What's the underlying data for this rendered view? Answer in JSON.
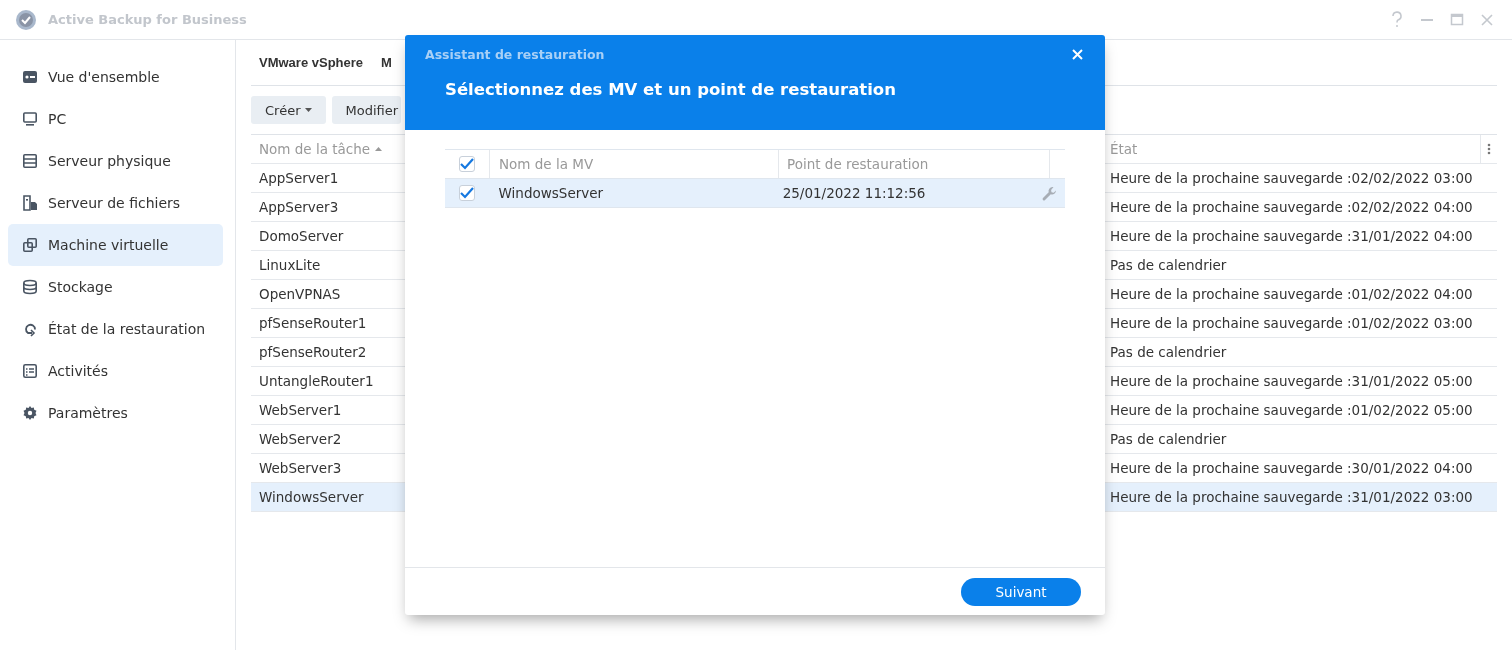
{
  "window": {
    "title": "Active Backup for Business"
  },
  "sidebar": {
    "items": [
      {
        "label": "Vue d'ensemble",
        "selected": false
      },
      {
        "label": "PC",
        "selected": false
      },
      {
        "label": "Serveur physique",
        "selected": false
      },
      {
        "label": "Serveur de fichiers",
        "selected": false
      },
      {
        "label": "Machine virtuelle",
        "selected": true
      },
      {
        "label": "Stockage",
        "selected": false
      },
      {
        "label": "État de la restauration",
        "selected": false
      },
      {
        "label": "Activités",
        "selected": false
      },
      {
        "label": "Paramètres",
        "selected": false
      }
    ]
  },
  "tabs": [
    {
      "label": "VMware vSphere"
    },
    {
      "label": "M"
    }
  ],
  "toolbar": {
    "buttons": [
      {
        "label": "Créer",
        "menu": true
      },
      {
        "label": "Modifier",
        "menu": false
      }
    ]
  },
  "table": {
    "columns": [
      {
        "label": "Nom de la tâche",
        "sorted": true
      },
      {
        "label": "État",
        "sorted": false
      }
    ],
    "rows": [
      {
        "name": "AppServer1",
        "state": "Heure de la prochaine sauvegarde :02/02/2022 03:00",
        "selected": false
      },
      {
        "name": "AppServer3",
        "state": "Heure de la prochaine sauvegarde :02/02/2022 04:00",
        "selected": false
      },
      {
        "name": "DomoServer",
        "state": "Heure de la prochaine sauvegarde :31/01/2022 04:00",
        "selected": false
      },
      {
        "name": "LinuxLite",
        "state": "Pas de calendrier",
        "selected": false
      },
      {
        "name": "OpenVPNAS",
        "state": "Heure de la prochaine sauvegarde :01/02/2022 04:00",
        "selected": false
      },
      {
        "name": "pfSenseRouter1",
        "state": "Heure de la prochaine sauvegarde :01/02/2022 03:00",
        "selected": false
      },
      {
        "name": "pfSenseRouter2",
        "state": "Pas de calendrier",
        "selected": false
      },
      {
        "name": "UntangleRouter1",
        "state": "Heure de la prochaine sauvegarde :31/01/2022 05:00",
        "selected": false
      },
      {
        "name": "WebServer1",
        "state": "Heure de la prochaine sauvegarde :01/02/2022 05:00",
        "selected": false
      },
      {
        "name": "WebServer2",
        "state": "Pas de calendrier",
        "selected": false
      },
      {
        "name": "WebServer3",
        "state": "Heure de la prochaine sauvegarde :30/01/2022 04:00",
        "selected": false
      },
      {
        "name": "WindowsServer",
        "state": "Heure de la prochaine sauvegarde :31/01/2022 03:00",
        "selected": true
      }
    ]
  },
  "dialog": {
    "title": "Assistant de restauration",
    "heading": "Sélectionnez des MV et un point de restauration",
    "table": {
      "all_checked": true,
      "columns": [
        "Nom de la MV",
        "Point de restauration"
      ],
      "rows": [
        {
          "name": "WindowsServer",
          "point": "25/01/2022 11:12:56",
          "checked": true,
          "selected": true
        }
      ]
    },
    "buttons": [
      {
        "label": "Suivant"
      }
    ]
  }
}
